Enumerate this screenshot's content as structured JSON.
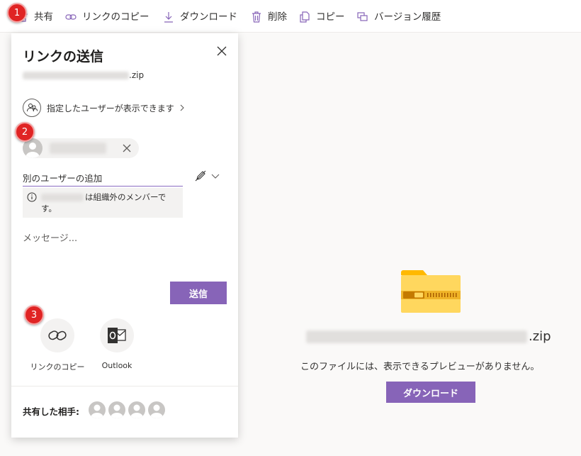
{
  "toolbar": {
    "share": "共有",
    "copy_link": "リンクのコピー",
    "download": "ダウンロード",
    "delete": "削除",
    "copy": "コピー",
    "version_history": "バージョン履歴"
  },
  "badges": [
    "1",
    "2",
    "3"
  ],
  "panel": {
    "title": "リンクの送信",
    "file_ext": ".zip",
    "permission": "指定したユーザーが表示できます",
    "add_user_placeholder": "別のユーザーの追加",
    "external_notice": "は組織外のメンバーです。",
    "message_placeholder": "メッセージ...",
    "send": "送信",
    "copy_link": "リンクのコピー",
    "outlook": "Outlook",
    "shared_with": "共有した相手:"
  },
  "preview": {
    "file_ext": ".zip",
    "no_preview": "このファイルには、表示できるプレビューがありません。",
    "download": "ダウンロード"
  },
  "colors": {
    "accent": "#8764b8",
    "badge": "#e02424",
    "folder": "#ffd15c"
  }
}
